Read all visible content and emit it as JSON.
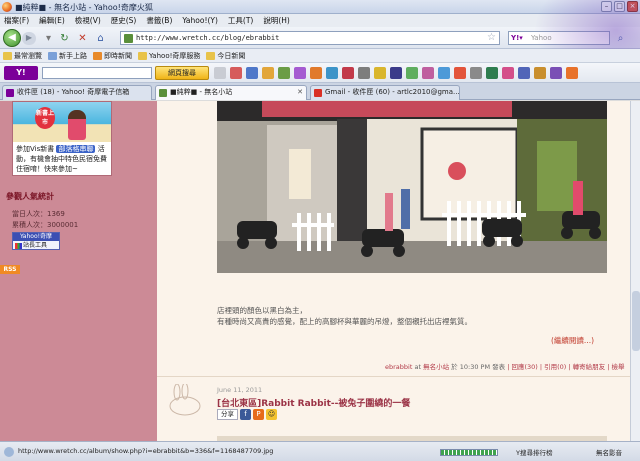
{
  "window": {
    "title": "■純粹■ - 無名小站 - Yahoo!奇摩火狐"
  },
  "menu": [
    "檔案(F)",
    "編輯(E)",
    "檢視(V)",
    "歷史(S)",
    "書籤(B)",
    "Yahoo!(Y)",
    "工具(T)",
    "說明(H)"
  ],
  "nav": {
    "url": "http://www.wretch.cc/blog/ebrabbit",
    "search_placeholder": "Yahoo"
  },
  "bookmarks": [
    "最常瀏覽",
    "新手上路",
    "即時新聞",
    "Yahoo!奇摩服務",
    "今日新聞"
  ],
  "yahoo_toolbar": {
    "logo": "Y!",
    "search_button": "網頁搜尋"
  },
  "tabs": [
    {
      "label": "收件匣 (18) - Yahoo! 奇摩電子信箱",
      "active": false,
      "color": "#7b0099"
    },
    {
      "label": "■純粹■ - 無名小站",
      "active": true,
      "color": "#5a8f3a"
    },
    {
      "label": "Gmail - 收件匣 (60) - artlc2010@gma...",
      "active": false,
      "color": "#d93025"
    }
  ],
  "sidebar": {
    "ad": {
      "badge": "新書上市",
      "text_prefix": "參加Vis新書",
      "tag": "部落格串聯",
      "text_suffix": "活動，有機會抽中特色民宿免費住宿唷！快來參加~"
    },
    "stats_title": "參觀人氣統計",
    "today_label": "當日人次",
    "today_value": "1369",
    "total_label": "累積人次",
    "total_value": "3000001",
    "counter_top": "Yahoo!奇摩",
    "counter_bottom": "站長工具",
    "rss": "RSS"
  },
  "post": {
    "desc_line1": "店裡頭的顏色以黑白為主，",
    "desc_line2": "有種時尚又高貴的感覺，配上的高腳杯與華麗的吊燈，整個襯托出店裡氣質。",
    "readmore": "(繼續閱讀...)",
    "meta_author": "ebrabbit",
    "meta_at": "at",
    "meta_site": "無名小站",
    "meta_time": "於 10:30 PM 發表",
    "meta_links": "| 回應(30) | 引用(0) | 轉寄給朋友 | 檢舉"
  },
  "next_post": {
    "date": "June 11, 2011",
    "title": "[台北東區]Rabbit Rabbit--被兔子圍繞的一餐",
    "share_label": "分享"
  },
  "status": {
    "url": "http://www.wretch.cc/album/show.php?i=ebrabbit&b=336&f=1168487709.jpg",
    "progress": 100,
    "rank": "Y搜尋排行榜",
    "mail": "無名影音"
  }
}
